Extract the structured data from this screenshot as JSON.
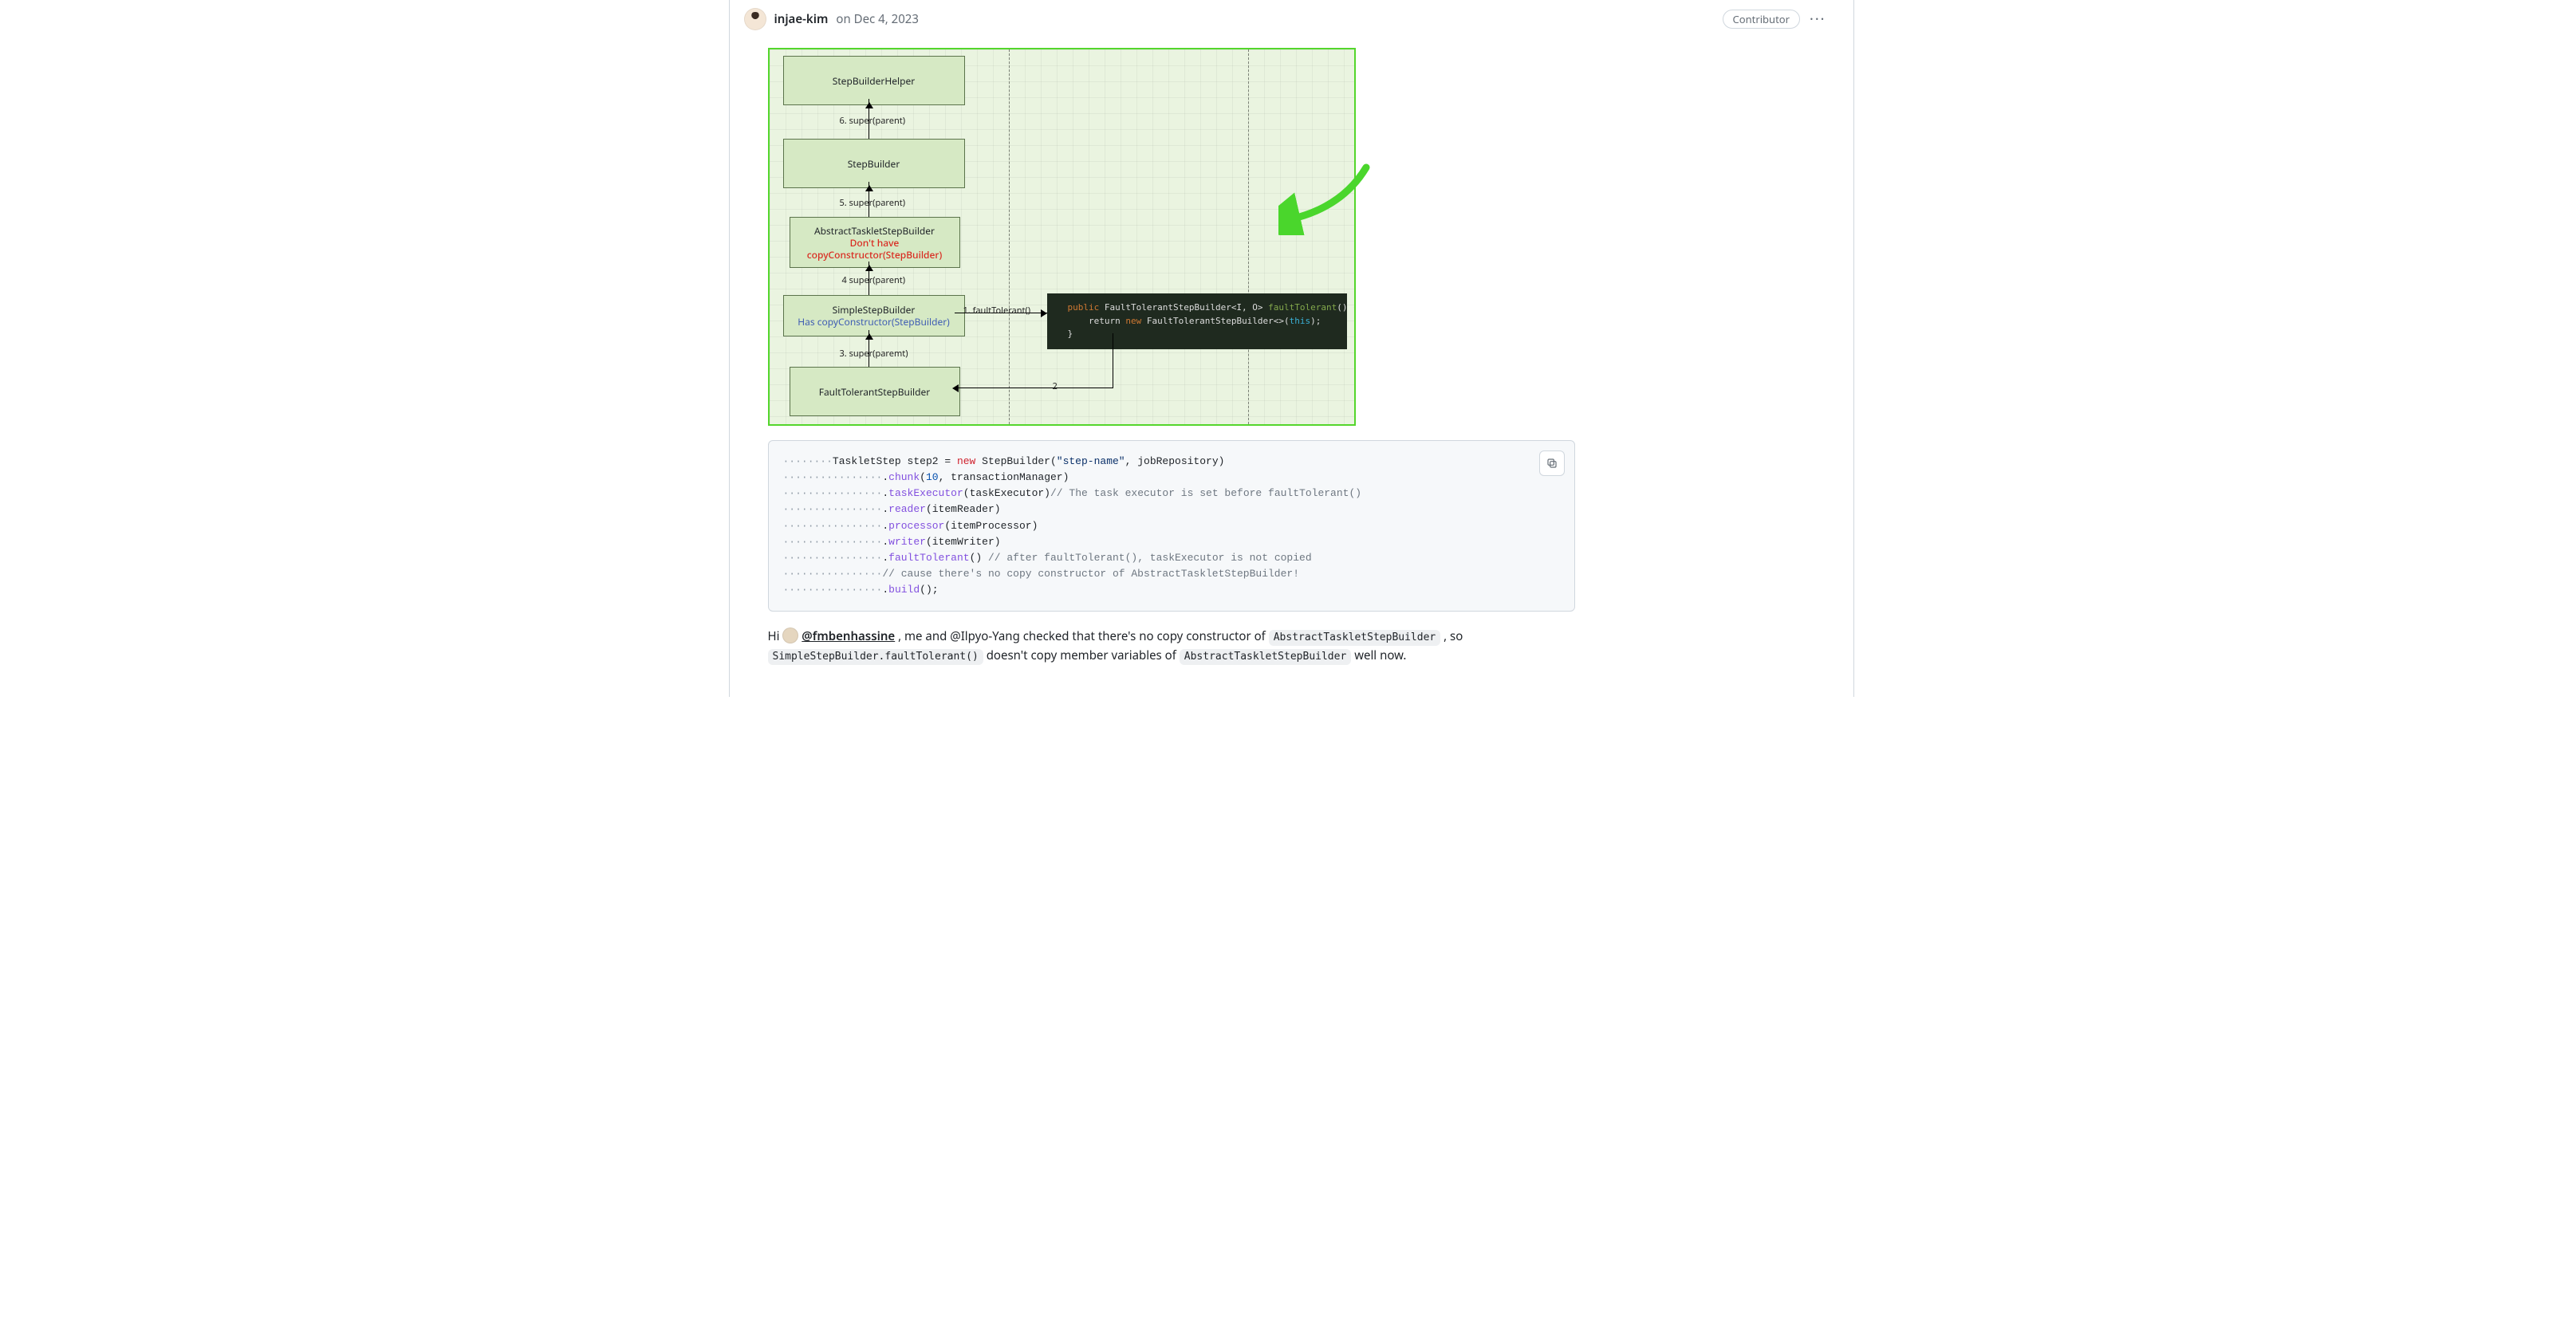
{
  "header": {
    "author": "injae-kim",
    "on_date": "on Dec 4, 2023",
    "badge": "Contributor"
  },
  "diagram": {
    "boxes": {
      "b1": "StepBuilderHelper",
      "b2": "StepBuilder",
      "b3_l1": "AbstractTaskletStepBuilder",
      "b3_l2": "Don't have",
      "b3_l3": "copyConstructor(StepBuilder)",
      "b4_l1": "SimpleStepBuilder",
      "b4_l2": "Has copyConstructor(StepBuilder)",
      "b5": "FaultTolerantStepBuilder"
    },
    "labels": {
      "l6": "6. super(parent)",
      "l5": "5. super(parent)",
      "l4": "4 super(parent)",
      "l1": "1. faultTolerant()",
      "l3": "3. super(paremt)",
      "l2": "2"
    },
    "code": {
      "line1a": "public",
      "line1b": " FaultTolerantStepBuilder<I, O> ",
      "line1c": "faultTolerant",
      "line1d": "() {",
      "line2a": "    return ",
      "line2b": "new",
      "line2c": " FaultTolerantStepBuilder<>(",
      "line2d": "this",
      "line2e": ");",
      "line3": "}"
    }
  },
  "code": {
    "indent1": "········",
    "indent2": "················",
    "l1_a": "TaskletStep step2 = ",
    "l1_b": "new",
    "l1_c": " StepBuilder(",
    "l1_d": "\"step-name\"",
    "l1_e": ", jobRepository)",
    "l2_a": ".",
    "l2_b": "chunk",
    "l2_c": "(",
    "l2_d": "10",
    "l2_e": ", transactionManager)",
    "l3_a": ".",
    "l3_b": "taskExecutor",
    "l3_c": "(taskExecutor)",
    "l3_d": "// The task executor is set before faultTolerant()",
    "l4_a": ".",
    "l4_b": "reader",
    "l4_c": "(itemReader)",
    "l5_a": ".",
    "l5_b": "processor",
    "l5_c": "(itemProcessor)",
    "l6_a": ".",
    "l6_b": "writer",
    "l6_c": "(itemWriter)",
    "l7_a": ".",
    "l7_b": "faultTolerant",
    "l7_c": "() ",
    "l7_d": "// after faultTolerant(), taskExecutor is not copied",
    "l8_a": "// cause there's no copy constructor of AbstractTaskletStepBuilder!",
    "l9_a": ".",
    "l9_b": "build",
    "l9_c": "();"
  },
  "para": {
    "t1": "Hi ",
    "mention": "@fmbenhassine",
    "t2": " , me and @Ilpyo-Yang checked that there's no copy constructor of ",
    "chip1": "AbstractTaskletStepBuilder",
    "t3": " , so ",
    "chip2": "SimpleStepBuilder.faultTolerant()",
    "t4": "  doesn't copy member variables of ",
    "chip3": "AbstractTaskletStepBuilder",
    "t5": "  well now."
  }
}
